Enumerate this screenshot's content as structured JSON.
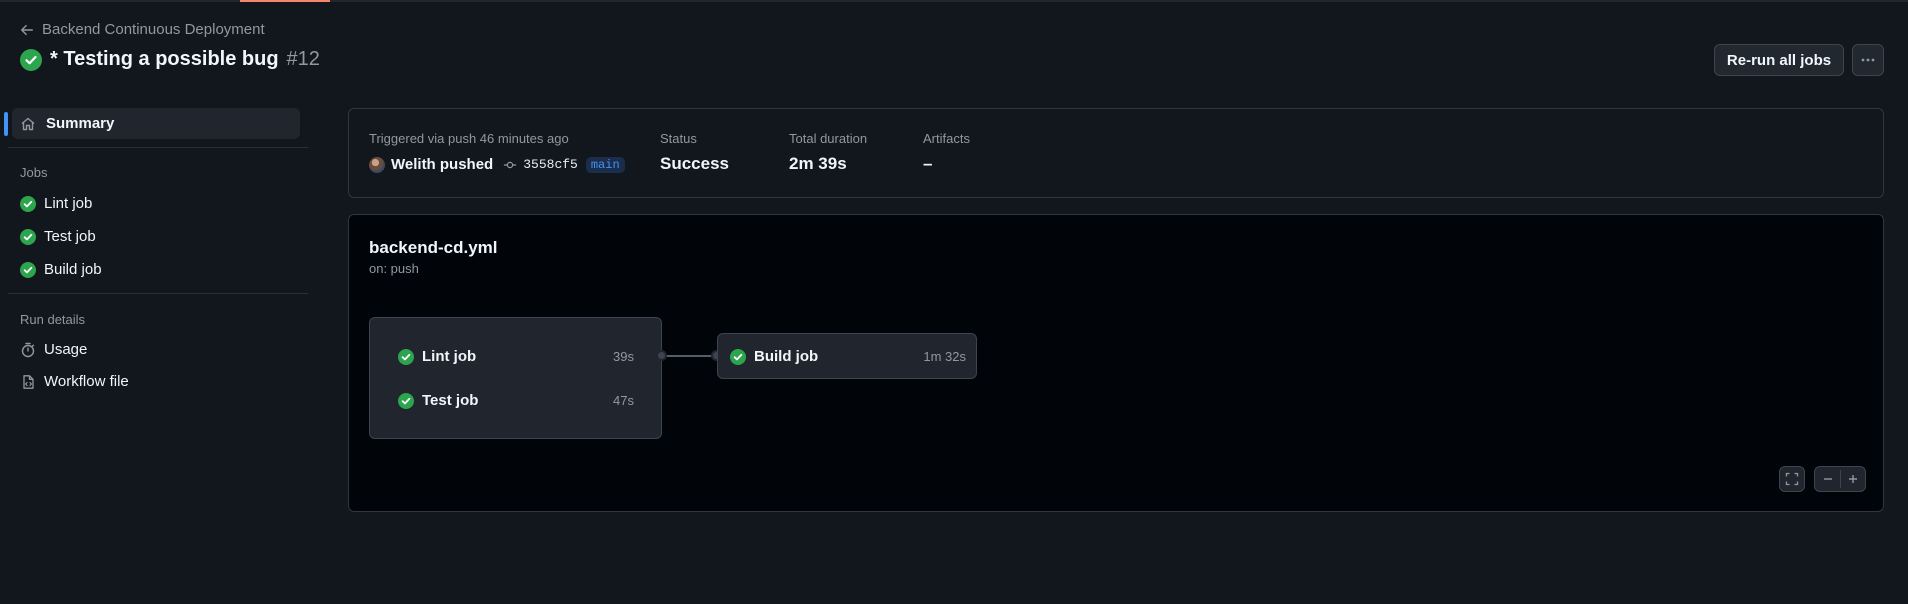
{
  "back_link": {
    "label": "Backend Continuous Deployment",
    "icon": "arrow-left-icon"
  },
  "header": {
    "title": "* Testing a possible bug",
    "run_number": "#12",
    "status_icon": "check-circle-icon",
    "rerun_label": "Re-run all jobs",
    "more_icon": "kebab-horizontal-icon"
  },
  "sidebar": {
    "summary_label": "Summary",
    "jobs_heading": "Jobs",
    "jobs": [
      {
        "label": "Lint job"
      },
      {
        "label": "Test job"
      },
      {
        "label": "Build job"
      }
    ],
    "run_details_heading": "Run details",
    "run_details": [
      {
        "label": "Usage",
        "icon": "stopwatch-icon"
      },
      {
        "label": "Workflow file",
        "icon": "file-code-icon"
      }
    ]
  },
  "summary": {
    "trigger_text": "Triggered via push 46 minutes ago",
    "actor_text": "Welith pushed",
    "commit_sha": "3558cf5",
    "branch": "main",
    "status_label": "Status",
    "status_value": "Success",
    "duration_label": "Total duration",
    "duration_value": "2m 39s",
    "artifacts_label": "Artifacts",
    "artifacts_value": "–"
  },
  "workflow": {
    "file_name": "backend-cd.yml",
    "trigger": "on: push",
    "group_jobs": [
      {
        "label": "Lint job",
        "duration": "39s"
      },
      {
        "label": "Test job",
        "duration": "47s"
      }
    ],
    "next_job": {
      "label": "Build job",
      "duration": "1m 32s"
    }
  },
  "colors": {
    "success": "#2da44e",
    "accent_blue": "#4493f8",
    "background": "#12161d",
    "graph_background": "#010409"
  }
}
